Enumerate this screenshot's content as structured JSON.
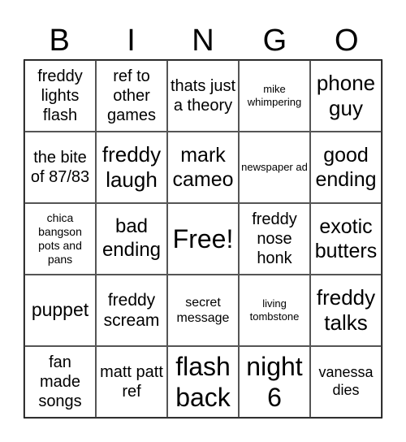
{
  "header": {
    "letters": [
      "B",
      "I",
      "N",
      "G",
      "O"
    ]
  },
  "cells": [
    [
      "freddy lights flash",
      "ref to other games",
      "thats just a theory",
      "mike whimpering",
      "phone guy"
    ],
    [
      "the bite of 87/83",
      "freddy laugh",
      "mark cameo",
      "newspaper ad",
      "good ending"
    ],
    [
      "chica bangson pots and pans",
      "bad ending",
      "Free!",
      "freddy nose honk",
      "exotic butters"
    ],
    [
      "puppet",
      "freddy scream",
      "secret message",
      "living tombstone",
      "freddy talks"
    ],
    [
      "fan made songs",
      "matt patt ref",
      "flash back",
      "night 6",
      "vanessa dies"
    ]
  ]
}
